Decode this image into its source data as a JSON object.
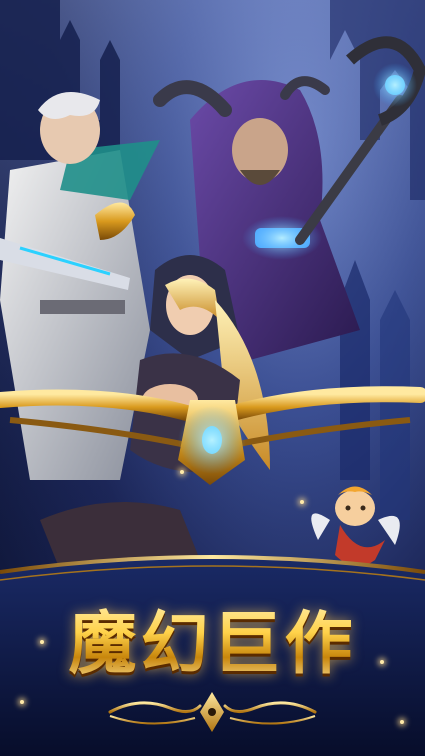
{
  "screen": {
    "title": "魔幻巨作"
  },
  "characters": [
    {
      "id": "silver-hair-swordsman",
      "name_icon": "swordsman-figure"
    },
    {
      "id": "horned-mage",
      "name_icon": "mage-figure"
    },
    {
      "id": "hooded-archer",
      "name_icon": "archer-figure"
    },
    {
      "id": "cupid-sprite",
      "name_icon": "cupid-figure"
    }
  ],
  "colors": {
    "gold": "#ffd24a",
    "gold_dark": "#c8860c",
    "banner_navy": "#0e1a4a",
    "sky_blue": "#6f86c9"
  }
}
